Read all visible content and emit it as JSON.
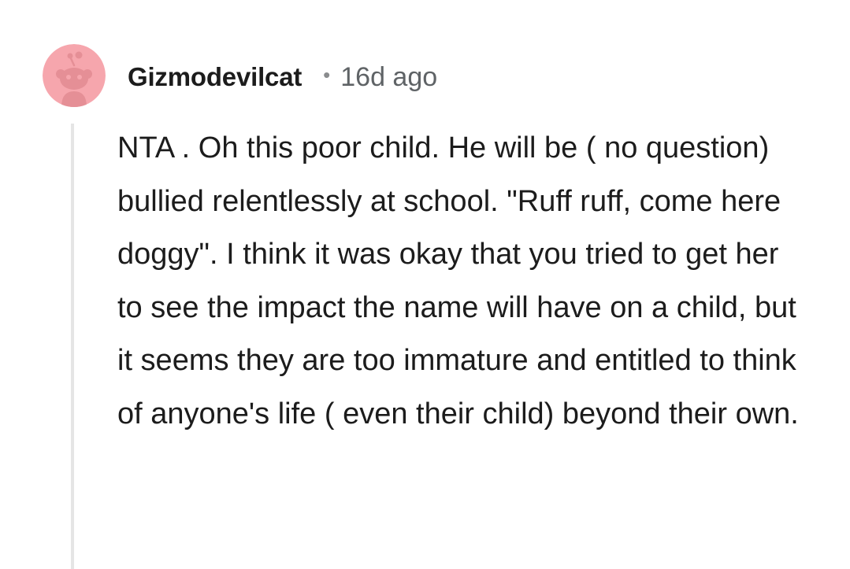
{
  "comment": {
    "author": "Gizmodevilcat",
    "separator": "•",
    "age": "16d ago",
    "avatar_icon": "reddit-snoo-avatar-icon",
    "avatar_color": "#f6a6ad",
    "body": "NTA . Oh this poor child. He will be ( no question) bullied relentlessly at school. \"Ruff ruff, come here doggy\". I think it was okay that you tried to get her to see the impact the name will have on a child, but it seems they are too immature and entitled to think of anyone's life ( even their child) beyond their own."
  }
}
